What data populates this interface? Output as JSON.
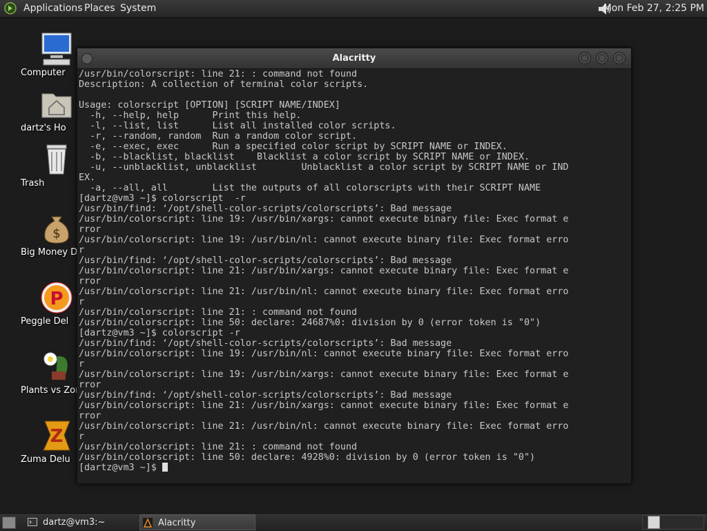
{
  "top_panel": {
    "menus": {
      "applications": "Applications",
      "places": "Places",
      "system": "System"
    },
    "clock": "Mon Feb 27,  2:25 PM",
    "icons": {
      "logo": "distro-logo-icon",
      "volume": "volume-icon"
    }
  },
  "desktop": {
    "icons": [
      {
        "label": "Computer",
        "icon": "computer-icon"
      },
      {
        "label": "dartz's Ho",
        "icon": "home-folder-icon"
      },
      {
        "label": "Trash",
        "icon": "trash-icon"
      },
      {
        "label": "Big Money D",
        "icon": "money-bag-icon"
      },
      {
        "label": "Peggle Del",
        "icon": "peggle-icon"
      },
      {
        "label": "Plants vs Zor",
        "icon": "plants-vs-zombies-icon"
      },
      {
        "label": "Zuma Delu",
        "icon": "zuma-icon"
      }
    ]
  },
  "terminal": {
    "title": "Alacritty",
    "lines": [
      "/usr/bin/colorscript: line 21: : command not found",
      "Description: A collection of terminal color scripts.",
      "",
      "Usage: colorscript [OPTION] [SCRIPT NAME/INDEX]",
      "  -h, --help, help      Print this help.",
      "  -l, --list, list      List all installed color scripts.",
      "  -r, --random, random  Run a random color script.",
      "  -e, --exec, exec      Run a specified color script by SCRIPT NAME or INDEX.",
      "  -b, --blacklist, blacklist    Blacklist a color script by SCRIPT NAME or INDEX.",
      "  -u, --unblacklist, unblacklist        Unblacklist a color script by SCRIPT NAME or IND",
      "EX.",
      "  -a, --all, all        List the outputs of all colorscripts with their SCRIPT NAME",
      "[dartz@vm3 ~]$ colorscript  -r",
      "/usr/bin/find: ‘/opt/shell-color-scripts/colorscripts’: Bad message",
      "/usr/bin/colorscript: line 19: /usr/bin/xargs: cannot execute binary file: Exec format e",
      "rror",
      "/usr/bin/colorscript: line 19: /usr/bin/nl: cannot execute binary file: Exec format erro",
      "r",
      "/usr/bin/find: ‘/opt/shell-color-scripts/colorscripts’: Bad message",
      "/usr/bin/colorscript: line 21: /usr/bin/xargs: cannot execute binary file: Exec format e",
      "rror",
      "/usr/bin/colorscript: line 21: /usr/bin/nl: cannot execute binary file: Exec format erro",
      "r",
      "/usr/bin/colorscript: line 21: : command not found",
      "/usr/bin/colorscript: line 50: declare: 24687%0: division by 0 (error token is \"0\")",
      "[dartz@vm3 ~]$ colorscript -r",
      "/usr/bin/find: ‘/opt/shell-color-scripts/colorscripts’: Bad message",
      "/usr/bin/colorscript: line 19: /usr/bin/nl: cannot execute binary file: Exec format erro",
      "r",
      "/usr/bin/colorscript: line 19: /usr/bin/xargs: cannot execute binary file: Exec format e",
      "rror",
      "/usr/bin/find: ‘/opt/shell-color-scripts/colorscripts’: Bad message",
      "/usr/bin/colorscript: line 21: /usr/bin/xargs: cannot execute binary file: Exec format e",
      "rror",
      "/usr/bin/colorscript: line 21: /usr/bin/nl: cannot execute binary file: Exec format erro",
      "r",
      "/usr/bin/colorscript: line 21: : command not found",
      "/usr/bin/colorscript: line 50: declare: 4928%0: division by 0 (error token is \"0\")"
    ],
    "prompt": "[dartz@vm3 ~]$ "
  },
  "bottom_panel": {
    "tasks": [
      {
        "label": "dartz@vm3:~",
        "icon": "terminal-icon"
      },
      {
        "label": "Alacritty",
        "icon": "alacritty-icon"
      }
    ],
    "icons": {
      "show_desktop": "show-desktop-icon",
      "workspace": "workspace-switcher"
    }
  },
  "colors": {
    "desktop_bg": "#1c1c1c",
    "terminal_bg": "#202020",
    "terminal_fg": "#c8c8c8",
    "panel_text": "#e8e8e8"
  }
}
